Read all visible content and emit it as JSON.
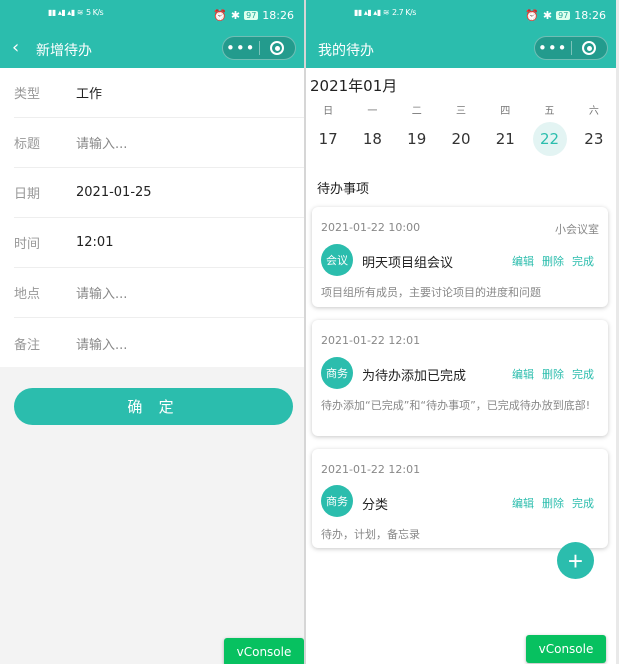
{
  "status": {
    "time": "18:26",
    "battery": "97",
    "speed_left": "5 K/s",
    "speed_right": "2.7 K/s"
  },
  "left": {
    "title": "新增待办",
    "form": [
      {
        "label": "类型",
        "value": "工作",
        "placeholder": false
      },
      {
        "label": "标题",
        "value": "请输入...",
        "placeholder": true
      },
      {
        "label": "日期",
        "value": "2021-01-25",
        "placeholder": false
      },
      {
        "label": "时间",
        "value": "12:01",
        "placeholder": false
      },
      {
        "label": "地点",
        "value": "请输入...",
        "placeholder": true
      },
      {
        "label": "备注",
        "value": "请输入...",
        "placeholder": true
      }
    ],
    "confirm_label": "确 定",
    "vconsole": "vConsole"
  },
  "right": {
    "title": "我的待办",
    "month": "2021年01月",
    "weekdays": [
      "日",
      "一",
      "二",
      "三",
      "四",
      "五",
      "六"
    ],
    "days": [
      "17",
      "18",
      "19",
      "20",
      "21",
      "22",
      "23"
    ],
    "selected_day": "22",
    "section_title": "待办事项",
    "todos": [
      {
        "time": "2021-01-22 10:00",
        "place": "小会议室",
        "tag": "会议",
        "title": "明天项目组会议",
        "desc": "项目组所有成员，主要讨论项目的进度和问题"
      },
      {
        "time": "2021-01-22 12:01",
        "place": "",
        "tag": "商务",
        "title": "为待办添加已完成",
        "desc": "待办添加“已完成”和“待办事项”，已完成待办放到底部!"
      },
      {
        "time": "2021-01-22 12:01",
        "place": "",
        "tag": "商务",
        "title": "分类",
        "desc": "待办，计划，备忘录"
      }
    ],
    "actions": {
      "edit": "编辑",
      "delete": "删除",
      "done": "完成"
    },
    "fab": "+",
    "vconsole": "vConsole"
  },
  "colors": {
    "primary": "#2bbdad",
    "vconsole": "#07c160"
  },
  "icons": {
    "back": "chevron-left-icon",
    "more": "more-dots-icon",
    "close": "target-icon",
    "add": "plus-icon"
  }
}
